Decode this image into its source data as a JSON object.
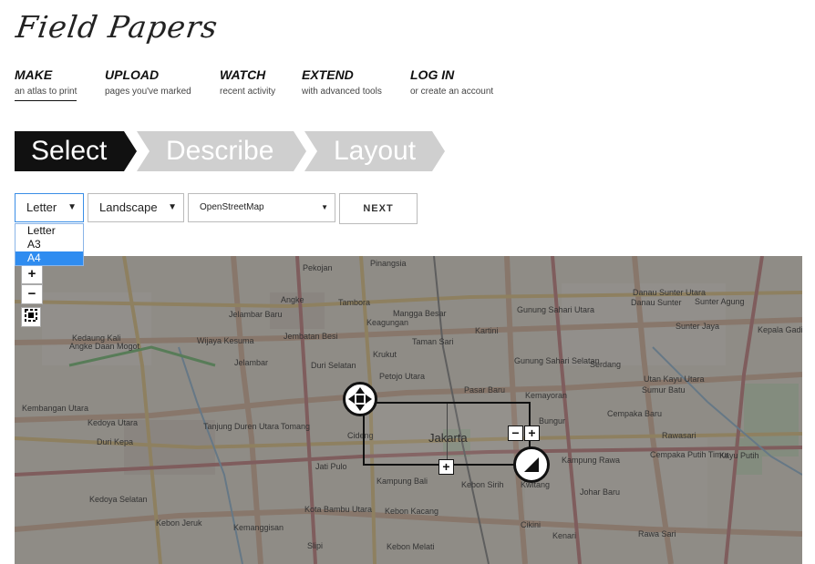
{
  "header": {
    "logo_text": "Field Papers"
  },
  "nav": [
    {
      "title": "MAKE",
      "sub": "an atlas to print"
    },
    {
      "title": "UPLOAD",
      "sub": "pages you've marked"
    },
    {
      "title": "WATCH",
      "sub": "recent activity"
    },
    {
      "title": "EXTEND",
      "sub": "with advanced tools"
    },
    {
      "title": "LOG IN",
      "sub": "or create an account"
    }
  ],
  "steps": [
    "Select",
    "Describe",
    "Layout"
  ],
  "controls": {
    "paper_size": "Letter",
    "orientation": "Landscape",
    "provider": "OpenStreetMap",
    "next_label": "NEXT",
    "paper_options": [
      "Letter",
      "A3",
      "A4"
    ],
    "highlighted_option": "A4"
  },
  "map": {
    "zoom_in": "+",
    "zoom_out": "−",
    "box_add": "+",
    "box_remove": "−",
    "box_plus": "+",
    "labels": [
      "Pinangsia",
      "Pekojan",
      "Angke",
      "Tambora",
      "Jelambar Baru",
      "Kedaung Kali",
      "Angke Daan Mogot",
      "Wijaya Kesuma",
      "Jembatan Besi",
      "Keagungan",
      "Mangga Besar",
      "Krukut",
      "Taman Sari",
      "Kartini",
      "Gunung Sahari Utara",
      "Sunter Jaya",
      "Kepala Gading",
      "Duri Selatan",
      "Petojo Utara",
      "Gunung Sahari Selatan",
      "Kemayoran",
      "Serdang",
      "Sumur Batu",
      "Pasar Baru",
      "Kembangan Utara",
      "Kedoya Utara",
      "Tanjung Duren Utara",
      "Tomang",
      "Bungur",
      "Cempaka Baru",
      "Duri Kepa",
      "Cideng",
      "Jakarta",
      "Kampung Rawa",
      "Cempaka Putih Timur",
      "Kayu Putih",
      "Jati Pulo",
      "Kampung Bali",
      "Kebon Sirih",
      "Kwitang",
      "Johar Baru",
      "Kedoya Selatan",
      "Kebon Jeruk",
      "Kota Bambu Utara",
      "Kebon Kacang",
      "Rawa Sari",
      "Kemanggisan",
      "Slipi",
      "Kebon Melati",
      "Cikini",
      "Kenari",
      "Danau Sunter Utara",
      "Danau Sunter",
      "Sunter Agung",
      "Jelambar",
      "Rawasari",
      "Utan Kayu Utara"
    ]
  }
}
